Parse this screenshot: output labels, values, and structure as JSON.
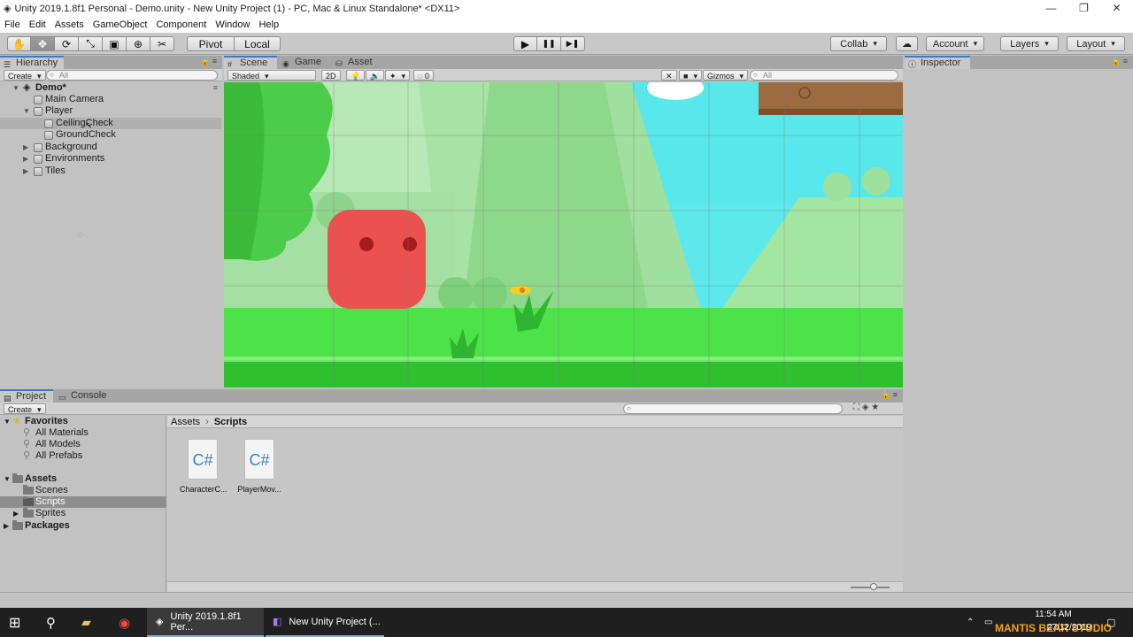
{
  "window": {
    "title": "Unity 2019.1.8f1 Personal - Demo.unity - New Unity Project (1) - PC, Mac & Linux Standalone* <DX11>",
    "minimize": "—",
    "maximize": "❐",
    "close": "✕"
  },
  "menu": [
    "File",
    "Edit",
    "Assets",
    "GameObject",
    "Component",
    "Window",
    "Help"
  ],
  "toolbar": {
    "tools": [
      "✋",
      "✥",
      "⟳",
      "⤡",
      "▣",
      "⊕",
      "✂"
    ],
    "pivot": "Pivot",
    "local": "Local",
    "play": "▶",
    "pause": "❚❚",
    "step": "▶❚",
    "collab": "Collab",
    "account": "Account",
    "layers": "Layers",
    "layout": "Layout"
  },
  "hierarchy": {
    "tab": "Hierarchy",
    "create": "Create",
    "search_placeholder": "All",
    "scene": "Demo*",
    "items": [
      {
        "label": "Main Camera",
        "depth": 1,
        "arrow": ""
      },
      {
        "label": "Player",
        "depth": 1,
        "arrow": "▼"
      },
      {
        "label": "CeilingCheck",
        "depth": 2,
        "arrow": ""
      },
      {
        "label": "GroundCheck",
        "depth": 2,
        "arrow": ""
      },
      {
        "label": "Background",
        "depth": 1,
        "arrow": "▶"
      },
      {
        "label": "Environments",
        "depth": 1,
        "arrow": "▶"
      },
      {
        "label": "Tiles",
        "depth": 1,
        "arrow": "▶"
      }
    ]
  },
  "scene_view": {
    "tabs": [
      "Scene",
      "Game",
      "Asset Store"
    ],
    "shading": "Shaded",
    "mode_2d": "2D",
    "hidden_count": "0",
    "gizmos": "Gizmos",
    "search_placeholder": "All"
  },
  "inspector": {
    "tab": "Inspector"
  },
  "project": {
    "tabs": [
      "Project",
      "Console"
    ],
    "create": "Create",
    "breadcrumb": [
      "Assets",
      "Scripts"
    ],
    "favorites": {
      "label": "Favorites",
      "items": [
        "All Materials",
        "All Models",
        "All Prefabs"
      ]
    },
    "assets": {
      "label": "Assets",
      "items": [
        "Scenes",
        "Scripts",
        "Sprites"
      ]
    },
    "packages": "Packages",
    "files": [
      {
        "label": "CharacterC...",
        "icon": "C#"
      },
      {
        "label": "PlayerMov...",
        "icon": "C#"
      }
    ]
  },
  "taskbar": {
    "apps": [
      "Unity 2019.1.8f1 Per...",
      "New Unity Project (..."
    ],
    "time": "11:54 AM",
    "date": "27/12/2019",
    "watermark": "MANTIS BEAR STUDIO"
  }
}
